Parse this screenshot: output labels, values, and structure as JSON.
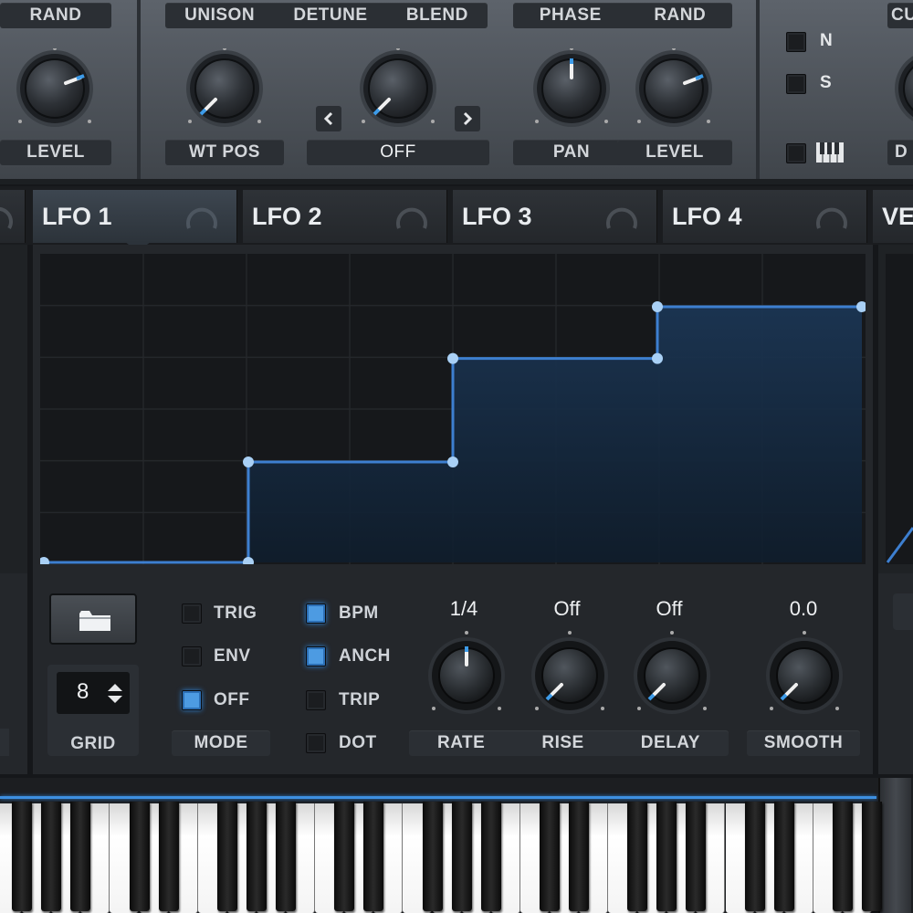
{
  "top": {
    "left": {
      "rand_label": "RAND",
      "level_label": "LEVEL"
    },
    "unison": {
      "unison_label": "UNISON",
      "detune_label": "DETUNE",
      "blend_label": "BLEND",
      "wtpos_label": "WT POS",
      "warp_value": "OFF",
      "prev_icon": "chevron-left-icon",
      "next_icon": "chevron-right-icon"
    },
    "phase": {
      "phase_label": "PHASE",
      "rand_label": "RAND",
      "pan_label": "PAN",
      "level_label": "LEVEL"
    },
    "routing": {
      "n_label": "N",
      "s_label": "S",
      "piano_icon": "piano-icon",
      "cut_label": "CU",
      "d_label": "D"
    }
  },
  "tabs": [
    {
      "label": "LFO 1",
      "active": true
    },
    {
      "label": "LFO 2",
      "active": false
    },
    {
      "label": "LFO 3",
      "active": false
    },
    {
      "label": "LFO 4",
      "active": false
    },
    {
      "label": "VE",
      "active": false
    }
  ],
  "lfo_graph": {
    "type": "step",
    "points": [
      [
        0,
        0
      ],
      [
        0.25,
        0
      ],
      [
        0.25,
        0.33
      ],
      [
        0.5,
        0.33
      ],
      [
        0.5,
        0.67
      ],
      [
        0.75,
        0.67
      ],
      [
        0.75,
        0.84
      ],
      [
        1.0,
        0.84
      ]
    ],
    "color": "#3d7fd0"
  },
  "bottom": {
    "folder_icon": "folder-icon",
    "grid_value": "8",
    "grid_label": "GRID",
    "mode_label": "MODE",
    "mode_options": [
      {
        "label": "TRIG",
        "on": false
      },
      {
        "label": "ENV",
        "on": false
      },
      {
        "label": "OFF",
        "on": true
      }
    ],
    "sync_options": [
      {
        "label": "BPM",
        "on": true
      },
      {
        "label": "ANCH",
        "on": true
      },
      {
        "label": "TRIP",
        "on": false
      },
      {
        "label": "DOT",
        "on": false
      }
    ],
    "rate": {
      "value": "1/4",
      "label": "RATE"
    },
    "rise": {
      "value": "Off",
      "label": "RISE"
    },
    "delay": {
      "value": "Off",
      "label": "DELAY"
    },
    "smooth": {
      "value": "0.0",
      "label": "SMOOTH"
    }
  },
  "colors": {
    "accent": "#3d8fe0",
    "panel": "#4a5058",
    "dark": "#15171a"
  }
}
